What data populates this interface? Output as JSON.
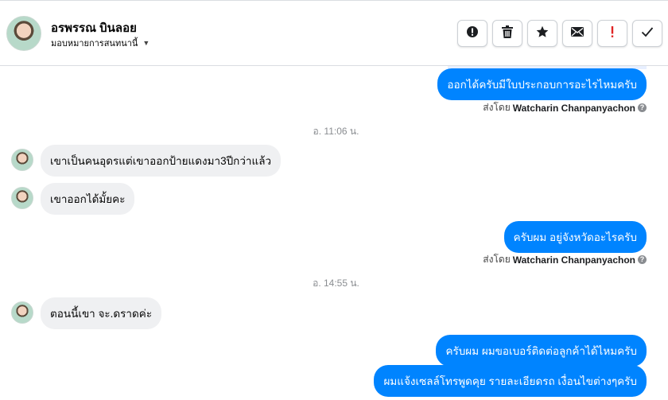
{
  "header": {
    "name": "อรพรรณ บินลอย",
    "assign_label": "มอบหมายการสนทนานี้",
    "actions": [
      {
        "name": "report-button",
        "icon": "alert-circle-icon",
        "glyph": "!"
      },
      {
        "name": "delete-button",
        "icon": "trash-icon",
        "glyph": "🗑"
      },
      {
        "name": "star-button",
        "icon": "star-icon",
        "glyph": "★"
      },
      {
        "name": "mark-unread-button",
        "icon": "envelope-icon",
        "glyph": "✉"
      },
      {
        "name": "follow-up-button",
        "icon": "exclamation-icon",
        "glyph": "!"
      },
      {
        "name": "done-button",
        "icon": "check-icon",
        "glyph": "✓"
      }
    ]
  },
  "thread": {
    "messages": [
      {
        "type": "out",
        "text": "ออกได้ครับมีใบประกอบการอะไรไหมครับ"
      },
      {
        "type": "sent_by",
        "prefix": "ส่งโดย",
        "name": "Watcharin Chanpanyachon"
      },
      {
        "type": "time",
        "text": "อ. 11:06 น."
      },
      {
        "type": "in",
        "text": "เขาเป็นคนอุดรแต่เขาออกป้ายแดงมา3ปีกว่าแล้ว"
      },
      {
        "type": "in",
        "text": "เขาออกได้มั้ยคะ"
      },
      {
        "type": "out",
        "text": "ครับผม อยู่จังหวัดอะไรครับ"
      },
      {
        "type": "sent_by",
        "prefix": "ส่งโดย",
        "name": "Watcharin Chanpanyachon"
      },
      {
        "type": "time",
        "text": "อ. 14:55 น."
      },
      {
        "type": "in",
        "text": "ตอนนี้เขา จะ.ดราดค่ะ"
      },
      {
        "type": "out",
        "text": "ครับผม ผมขอเบอร์ติดต่อลูกค้าได้ไหมครับ"
      },
      {
        "type": "out",
        "text": "ผมแจ้งเซลล์โทรพูดคุย รายละเอียดรถ เงื่อนไขต่างๆครับ"
      }
    ]
  },
  "colors": {
    "outgoing_bubble": "#0084ff",
    "incoming_bubble": "#eff0f2",
    "follow_up_icon": "#e02424"
  }
}
